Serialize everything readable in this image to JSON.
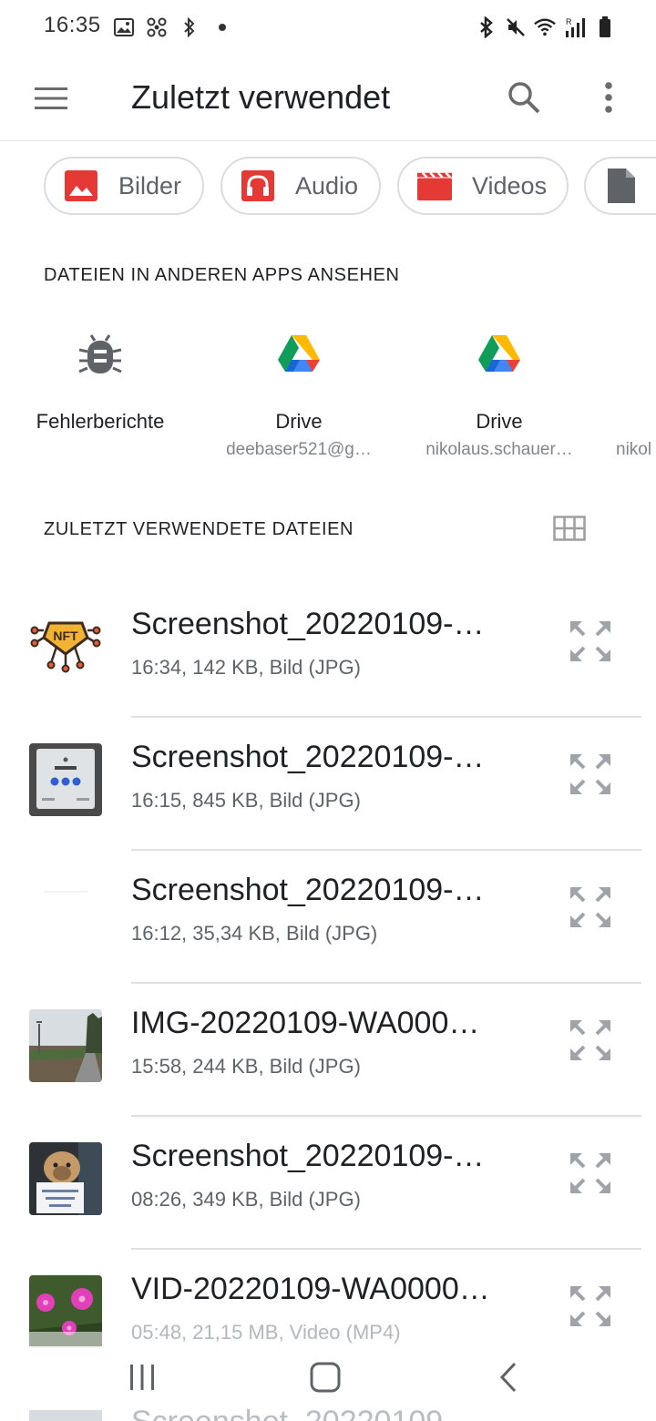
{
  "status_bar": {
    "time": "16:35",
    "left_icons": [
      "image-icon",
      "fan-icon",
      "bluetooth-icon",
      "dot-icon"
    ],
    "right_icons": [
      "bluetooth-icon",
      "mute-icon",
      "wifi-icon",
      "signal-icon",
      "battery-icon"
    ],
    "signal_label": "R"
  },
  "app_bar": {
    "title": "Zuletzt verwendet",
    "menu_icon": "hamburger-icon",
    "search_icon": "search-icon",
    "more_icon": "more-vert-icon"
  },
  "chips": [
    {
      "label": "Bilder",
      "icon": "image-icon",
      "color": "#e53935"
    },
    {
      "label": "Audio",
      "icon": "headphones-icon",
      "color": "#e53935"
    },
    {
      "label": "Videos",
      "icon": "clapperboard-icon",
      "color": "#e53935"
    },
    {
      "label": "",
      "icon": "document-icon",
      "color": "#5f6368"
    }
  ],
  "other_apps": {
    "title": "DATEIEN IN ANDEREN APPS ANSEHEN",
    "items": [
      {
        "label": "Fehlerberichte",
        "sub": "",
        "icon": "bug-icon"
      },
      {
        "label": "Drive",
        "sub": "deebaser521@g…",
        "icon": "drive-icon"
      },
      {
        "label": "Drive",
        "sub": "nikolaus.schauer…",
        "icon": "drive-icon"
      },
      {
        "label": "",
        "sub": "nikol",
        "icon": "drive-icon"
      }
    ]
  },
  "recent": {
    "title": "ZULETZT VERWENDETE DATEIEN",
    "view_icon": "grid-view-icon",
    "files": [
      {
        "name": "Screenshot_20220109-…",
        "meta": "16:34, 142 KB, Bild (JPG)",
        "thumb": "nft"
      },
      {
        "name": "Screenshot_20220109-…",
        "meta": "16:15, 845 KB, Bild (JPG)",
        "thumb": "app-screen"
      },
      {
        "name": "Screenshot_20220109-…",
        "meta": "16:12, 35,34 KB, Bild (JPG)",
        "thumb": "blank"
      },
      {
        "name": "IMG-20220109-WA000…",
        "meta": "15:58, 244 KB, Bild (JPG)",
        "thumb": "landscape"
      },
      {
        "name": "Screenshot_20220109-…",
        "meta": "08:26, 349 KB, Bild (JPG)",
        "thumb": "dog"
      },
      {
        "name": "VID-20220109-WA0000…",
        "meta": "05:48, 21,15 MB, Video (MP4)",
        "thumb": "flowers"
      }
    ],
    "peek_name": "Screenshot_20220109-"
  },
  "nav_bar": {
    "recents_icon": "recents-icon",
    "home_icon": "home-icon",
    "back_icon": "back-icon"
  },
  "colors": {
    "accent_red": "#e53935",
    "text_primary": "#202124",
    "text_secondary": "#5f6368",
    "divider": "#e0e0e0"
  }
}
